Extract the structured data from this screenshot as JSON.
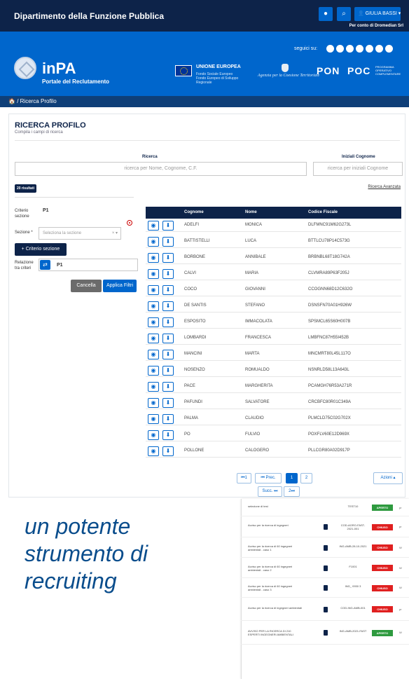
{
  "topbar": {
    "title": "Dipartimento della Funzione Pubblica",
    "user": "GIULIA BASSI",
    "per_conto": "Per conto di Dromedian Srl"
  },
  "header": {
    "seguici": "seguici su:",
    "brand": "inPA",
    "brand_sub": "Portale del Reclutamento",
    "eu_title": "UNIONE EUROPEA",
    "eu_sub": "Fondo Sociale Europeo\nFondo Europeo di Sviluppo Regionale",
    "agenzia": "Agenzia per la Coesione Territoriale",
    "pon": "PON",
    "poc": "POC",
    "poc_sub": "PROGRAMMA OPERATIVO COMPLEMENTARE"
  },
  "breadcrumb": {
    "label": "Ricerca Profilo"
  },
  "search": {
    "title": "RICERCA PROFILO",
    "subtitle": "Compila i campi di ricerca",
    "ricerca_label": "Ricerca",
    "ricerca_placeholder": "ricerca per Nome, Cognome, C.F.",
    "iniziali_label": "Iniziali Cognome",
    "iniziali_placeholder": "ricerca per iniziali Cognome",
    "results": "20 risultati",
    "advanced": "Ricerca Avanzata"
  },
  "filters": {
    "criterio_label": "Criterio sezione",
    "criterio_value": "P1",
    "sezione_label": "Sezione *",
    "sezione_placeholder": "Seleziona la sezione",
    "add_button": "+ Criterio sezione",
    "relazione_label": "Relazione tra criteri",
    "relazione_value": "P1",
    "cancel": "Cancella",
    "apply": "Applica Filtri"
  },
  "table": {
    "headers": [
      "Cognome",
      "Nome",
      "Codice Fiscale"
    ],
    "rows": [
      [
        "ADELFI",
        "MONICA",
        "DLFMNC91M62G273L"
      ],
      [
        "BATTISTELLI",
        "LUCA",
        "BTTLCU78P14C573G"
      ],
      [
        "BORBONE",
        "ANNIBALE",
        "BRBNBL68T18G742A"
      ],
      [
        "CALVI",
        "MARIA",
        "CLVMRA89P63F205J"
      ],
      [
        "COCO",
        "GIOVANNI",
        "CCOGNN68D12C632O"
      ],
      [
        "DE SANTIS",
        "STEFANO",
        "DSNSFN70A01H926W"
      ],
      [
        "ESPOSITO",
        "IMMACOLATA",
        "SPSMCL65S60H007B"
      ],
      [
        "LOMBARDI",
        "FRANCESCA",
        "LMBFNC87H55I452B"
      ],
      [
        "MANCINI",
        "MARTA",
        "MNCMRT80L45L117O"
      ],
      [
        "NOSENZO",
        "ROMUALDO",
        "NSNRLD58L13A643L"
      ],
      [
        "PACE",
        "MARGHERITA",
        "PCAMGH76R53A271R"
      ],
      [
        "PAFUNDI",
        "SALVATORE",
        "CRCBFC80R01C349A"
      ],
      [
        "PALMA",
        "CLAUDIO",
        "PLMCLD75C02G702X"
      ],
      [
        "PO",
        "FULVIO",
        "POXFLV60E12D969X"
      ],
      [
        "POLLONE",
        "CALOGERO",
        "PLLCGR80A02D917P"
      ]
    ]
  },
  "pagination": {
    "first": "1",
    "prev": "Prec.",
    "pages": [
      "1",
      "2"
    ],
    "next": "Succ.",
    "last": "2",
    "actions": "Azioni"
  },
  "tagline": "un potente strumento di recruiting",
  "second_screen": {
    "rows": [
      {
        "desc": "selezione di test",
        "code": "TEST10",
        "status": "APERTO",
        "extra": "pr"
      },
      {
        "desc": "Avviso per la ricerca di ingegneri",
        "code": "COD-AGRO-FAST-2021-001",
        "status": "CHIUSO",
        "extra": "pr"
      },
      {
        "desc": "Avviso per la ricerca di 60 ingegneri ambientali - caso 1",
        "code": "ING-AMB-28-10-2021",
        "status": "CHIUSO",
        "extra": "W"
      },
      {
        "desc": "Avviso per la ricerca di 60 ingegneri ambientali - caso 2",
        "code": "F1001",
        "status": "CHIUSO",
        "extra": "W"
      },
      {
        "desc": "Avviso per la ricerca di 60 ingegneri ambientali - caso 3",
        "code": "ING_ 0930 3",
        "status": "CHIUSO",
        "extra": "W"
      },
      {
        "desc": "Avviso per la ricerca di ingegneri ambientali",
        "code": "COD-ING-AMB-001",
        "status": "CHIUSO",
        "extra": "pr"
      },
      {
        "desc": "AVVISO PER LA RICERCA DI 210 ESPERTI INGEGNERI AMBIENTALI",
        "code": "ING-AMB-2021-FAST",
        "status": "APERTO",
        "extra": "W"
      }
    ]
  },
  "colors": {
    "navy": "#0d2349",
    "blue": "#0066cc",
    "open": "#2e9a3f",
    "closed": "#e02020"
  }
}
